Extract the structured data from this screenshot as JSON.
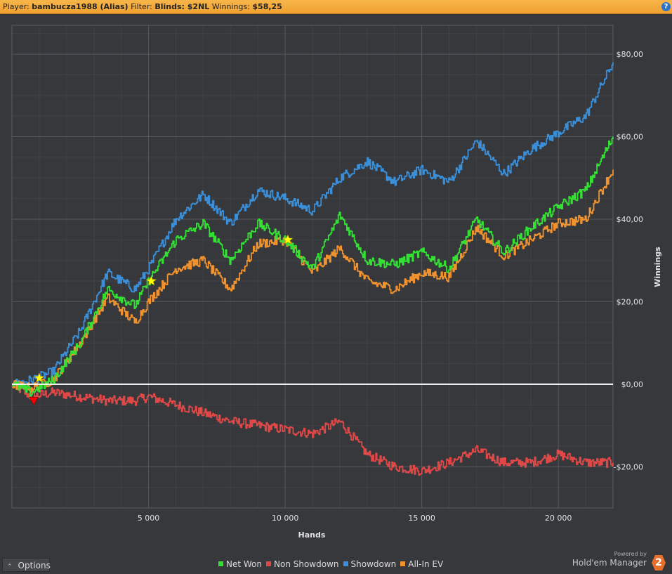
{
  "header": {
    "player_label": "Player:",
    "player_value": "bambucza1988 (Alias)",
    "filter_label": "Filter:",
    "filter_value": "Blinds: $2NL",
    "winnings_label": "Winnings:",
    "winnings_value": "$58,25",
    "help_icon": "help-icon"
  },
  "footer": {
    "options_label": "Options",
    "powered_by": "Powered by",
    "brand": "Hold'em Manager",
    "badge": "2"
  },
  "colors": {
    "net_won": "#33e033",
    "non_showdown": "#e04848",
    "showdown": "#3a8fd8",
    "allin_ev": "#f0922e",
    "zero_line": "#ffffff",
    "star": "#ffff00",
    "min_marker": "#ff0000"
  },
  "chart_data": {
    "type": "line",
    "xlabel": "Hands",
    "ylabel": "Winnings",
    "xlim": [
      0,
      22000
    ],
    "ylim": [
      -30,
      87
    ],
    "x_ticks": [
      5000,
      10000,
      15000,
      20000
    ],
    "x_tick_labels": [
      "5 000",
      "10 000",
      "15 000",
      "20 000"
    ],
    "y_ticks": [
      80,
      60,
      40,
      20,
      0,
      -20
    ],
    "y_tick_labels": [
      "$80,00",
      "$60,00",
      "$40,00",
      "$20,00",
      "$0,00",
      "-$20,00"
    ],
    "grid": true,
    "legend_position": "bottom",
    "series": [
      {
        "name": "Net Won",
        "color": "#33e033",
        "x": [
          0,
          700,
          1500,
          2500,
          3500,
          4500,
          5000,
          6000,
          7000,
          8000,
          9000,
          10000,
          11000,
          12000,
          13000,
          14000,
          15000,
          16000,
          17000,
          18000,
          19000,
          20000,
          21000,
          22000
        ],
        "values": [
          0,
          -2,
          1,
          10,
          23,
          19,
          25,
          35,
          39,
          30,
          39,
          35,
          28,
          41,
          30,
          29,
          32,
          28,
          40,
          32,
          38,
          43,
          47,
          60
        ]
      },
      {
        "name": "Non Showdown",
        "color": "#e04848",
        "x": [
          0,
          700,
          1500,
          2500,
          3500,
          4500,
          5000,
          6000,
          7000,
          8000,
          9000,
          10000,
          11000,
          12000,
          13000,
          14000,
          15000,
          16000,
          17000,
          18000,
          19000,
          20000,
          21000,
          22000
        ],
        "values": [
          0,
          -3,
          -2,
          -3,
          -4,
          -4,
          -3,
          -5,
          -7,
          -9,
          -10,
          -11,
          -12,
          -9,
          -17,
          -20,
          -21,
          -19,
          -16,
          -19,
          -19,
          -17,
          -19,
          -19
        ]
      },
      {
        "name": "Showdown",
        "color": "#3a8fd8",
        "x": [
          0,
          700,
          1500,
          2500,
          3500,
          4500,
          5000,
          6000,
          7000,
          8000,
          9000,
          10000,
          11000,
          12000,
          13000,
          14000,
          15000,
          16000,
          17000,
          18000,
          19000,
          20000,
          21000,
          22000
        ],
        "values": [
          0,
          1,
          3,
          13,
          27,
          23,
          28,
          40,
          46,
          39,
          47,
          45,
          42,
          50,
          54,
          49,
          52,
          49,
          59,
          51,
          57,
          61,
          65,
          78
        ]
      },
      {
        "name": "All-In EV",
        "color": "#f0922e",
        "x": [
          0,
          700,
          1500,
          2500,
          3500,
          4500,
          5000,
          6000,
          7000,
          8000,
          9000,
          10000,
          11000,
          12000,
          13000,
          14000,
          15000,
          16000,
          17000,
          18000,
          19000,
          20000,
          21000,
          22000
        ],
        "values": [
          0,
          -1,
          1,
          10,
          21,
          15,
          20,
          28,
          30,
          23,
          34,
          35,
          27,
          33,
          25,
          23,
          27,
          26,
          38,
          31,
          35,
          39,
          40,
          52
        ]
      }
    ],
    "markers": [
      {
        "type": "star",
        "x": 1000,
        "y": 1.5
      },
      {
        "type": "star",
        "x": 5100,
        "y": 25
      },
      {
        "type": "star",
        "x": 10100,
        "y": 35
      },
      {
        "type": "min",
        "x": 800,
        "y": -4
      }
    ]
  }
}
